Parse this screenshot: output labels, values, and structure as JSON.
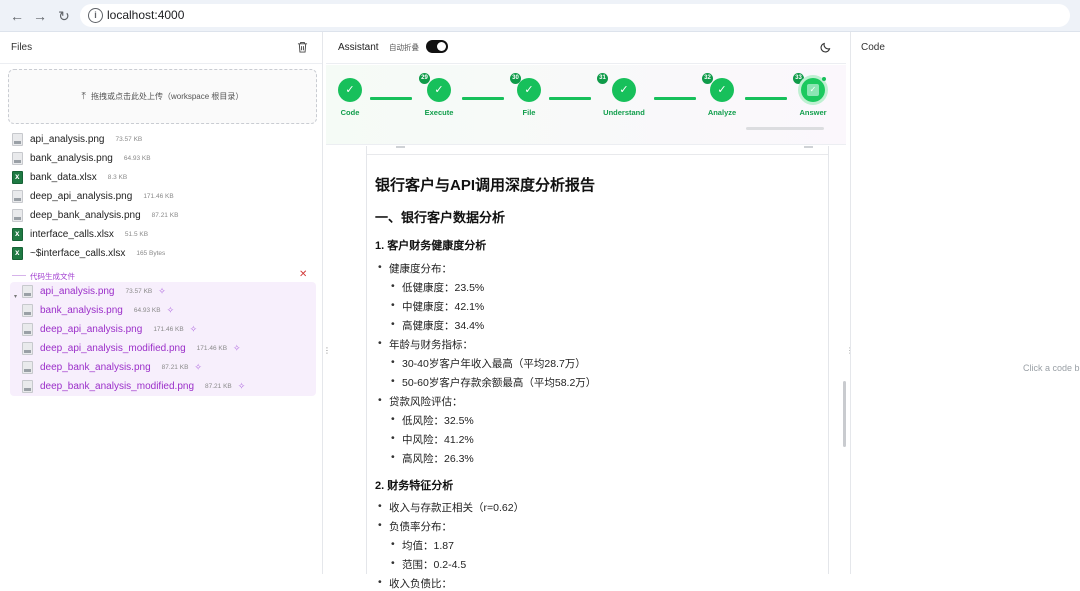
{
  "browser": {
    "url": "localhost:4000",
    "back_icon": "arrow-left-icon",
    "forward_icon": "arrow-right-icon",
    "reload_icon": "reload-icon"
  },
  "files_panel": {
    "title": "Files",
    "upload_text": "拖拽或点击此处上传（workspace 根目录）",
    "files": [
      {
        "name": "api_analysis.png",
        "size": "73.57 KB",
        "type": "png"
      },
      {
        "name": "bank_analysis.png",
        "size": "64.93 KB",
        "type": "png"
      },
      {
        "name": "bank_data.xlsx",
        "size": "8.3 KB",
        "type": "xlsx"
      },
      {
        "name": "deep_api_analysis.png",
        "size": "171.46 KB",
        "type": "png"
      },
      {
        "name": "deep_bank_analysis.png",
        "size": "87.21 KB",
        "type": "png"
      },
      {
        "name": "interface_calls.xlsx",
        "size": "51.5 KB",
        "type": "xlsx"
      },
      {
        "name": "~$interface_calls.xlsx",
        "size": "165 Bytes",
        "type": "xlsx"
      }
    ],
    "generated_label": "代码生成文件",
    "generated_files": [
      {
        "name": "api_analysis.png",
        "size": "73.57 KB"
      },
      {
        "name": "bank_analysis.png",
        "size": "64.93 KB"
      },
      {
        "name": "deep_api_analysis.png",
        "size": "171.46 KB"
      },
      {
        "name": "deep_api_analysis_modified.png",
        "size": "171.46 KB"
      },
      {
        "name": "deep_bank_analysis.png",
        "size": "87.21 KB"
      },
      {
        "name": "deep_bank_analysis_modified.png",
        "size": "87.21 KB"
      }
    ]
  },
  "assistant_panel": {
    "title": "Assistant",
    "auto_fold_label": "自动折叠",
    "auto_fold_on": true,
    "steps": [
      {
        "number": "",
        "label": "Code"
      },
      {
        "number": "29",
        "label": "Execute"
      },
      {
        "number": "30",
        "label": "File"
      },
      {
        "number": "31",
        "label": "Understand"
      },
      {
        "number": "32",
        "label": "Analyze"
      },
      {
        "number": "33",
        "label": "Answer"
      }
    ],
    "report": {
      "title": "银行客户与API调用深度分析报告",
      "section1": "一、银行客户数据分析",
      "sub1": "1. 客户财务健康度分析",
      "health_dist": "健康度分布：",
      "low_health": "低健康度：23.5%",
      "mid_health": "中健康度：42.1%",
      "high_health": "高健康度：34.4%",
      "age_finance": "年龄与财务指标：",
      "age_1": "30-40岁客户年收入最高（平均28.7万）",
      "age_2": "50-60岁客户存款余额最高（平均58.2万）",
      "loan_risk": "贷款风险评估：",
      "low_risk": "低风险：32.5%",
      "mid_risk": "中风险：41.2%",
      "high_risk": "高风险：26.3%",
      "sub2": "2. 财务特征分析",
      "income_corr": "收入与存款正相关（r=0.62）",
      "debt_dist": "负债率分布：",
      "mean": "均值：1.87",
      "range": "范围：0.2-4.5",
      "income_debt": "收入负债比："
    }
  },
  "code_panel": {
    "title": "Code",
    "hint": "Click a code b"
  }
}
